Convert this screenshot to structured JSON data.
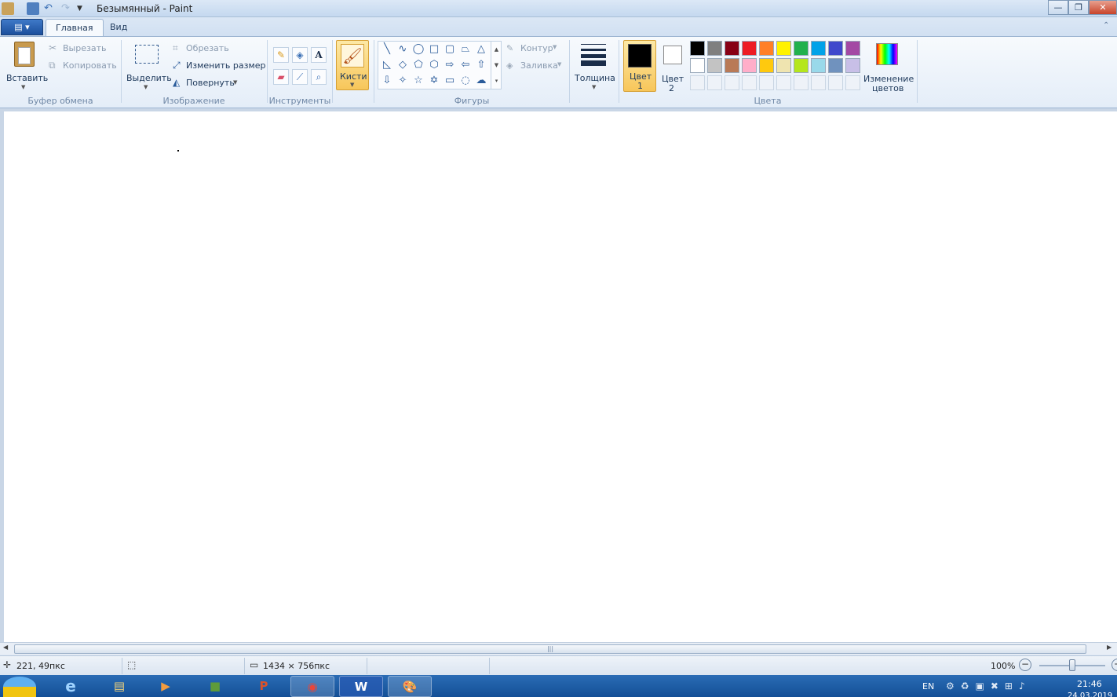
{
  "titlebar": {
    "title": "Безымянный - Paint"
  },
  "tabs": [
    {
      "label": "Главная"
    },
    {
      "label": "Вид"
    }
  ],
  "clipboard": {
    "paste": "Вставить",
    "cut": "Вырезать",
    "copy": "Копировать",
    "group": "Буфер обмена"
  },
  "image": {
    "select": "Выделить",
    "crop": "Обрезать",
    "resize": "Изменить размер",
    "rotate": "Повернуть",
    "group": "Изображение"
  },
  "tools": {
    "group": "Инструменты"
  },
  "brushes": {
    "label": "Кисти"
  },
  "shapes": {
    "outline": "Контур",
    "fill": "Заливка",
    "group": "Фигуры"
  },
  "size": {
    "label": "Толщина"
  },
  "colors": {
    "color1_line1": "Цвет",
    "color1_line2": "1",
    "color2_line1": "Цвет",
    "color2_line2": "2",
    "edit_line1": "Изменение",
    "edit_line2": "цветов",
    "group": "Цвета",
    "color1_value": "#000000",
    "color2_value": "#ffffff",
    "palette_row1": [
      "#000000",
      "#7f7f7f",
      "#880015",
      "#ed1c24",
      "#ff7f27",
      "#fff200",
      "#22b14c",
      "#00a2e8",
      "#3f48cc",
      "#a349a4"
    ],
    "palette_row2": [
      "#ffffff",
      "#c3c3c3",
      "#b97a57",
      "#ffaec9",
      "#ffc90e",
      "#efe4b0",
      "#b5e61d",
      "#99d9ea",
      "#7092be",
      "#c8bfe7"
    ]
  },
  "status": {
    "cursor": "221, 49пкс",
    "size": "1434 × 756пкс",
    "zoom": "100%"
  },
  "taskbar": {
    "lang": "EN",
    "time": "21:46",
    "date": "24.03.2019"
  }
}
